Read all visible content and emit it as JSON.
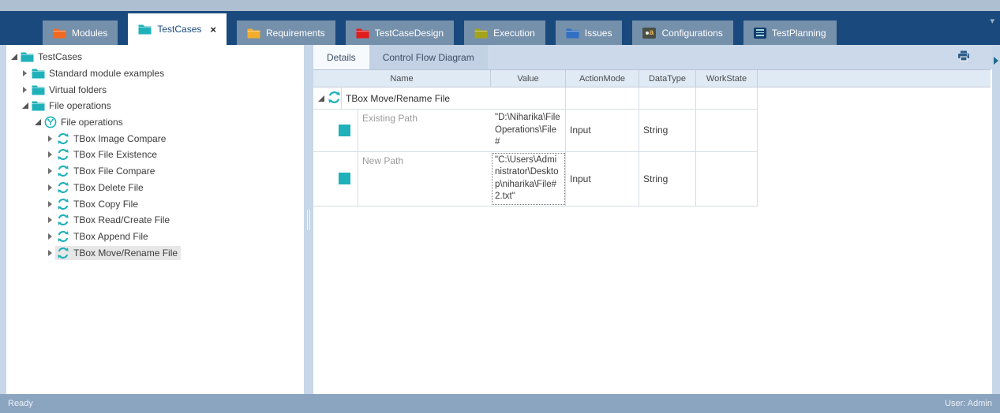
{
  "tabs": {
    "items": [
      {
        "label": "Modules",
        "icon": "folder",
        "color": "#f26a22",
        "active": false
      },
      {
        "label": "TestCases",
        "icon": "folder",
        "color": "#1fb1ba",
        "active": true,
        "close_glyph": "×"
      },
      {
        "label": "Requirements",
        "icon": "folder",
        "color": "#f2ad2d",
        "active": false
      },
      {
        "label": "TestCaseDesign",
        "icon": "folder",
        "color": "#e01d1d",
        "active": false
      },
      {
        "label": "Execution",
        "icon": "folder",
        "color": "#a3a41a",
        "active": false
      },
      {
        "label": "Issues",
        "icon": "folder",
        "color": "#2f6fc4",
        "active": false
      },
      {
        "label": "Configurations",
        "icon": "configurations",
        "config_a": "a",
        "active": false
      },
      {
        "label": "TestPlanning",
        "icon": "planning-list",
        "active": false
      }
    ],
    "overflow_glyph": "▾"
  },
  "tree": {
    "items": [
      {
        "label": "TestCases",
        "level": 0,
        "expander": "expanded",
        "icon": "folder-teal"
      },
      {
        "label": "Standard module examples",
        "level": 1,
        "expander": "collapsed",
        "icon": "folder-teal"
      },
      {
        "label": "Virtual folders",
        "level": 1,
        "expander": "collapsed",
        "icon": "folder-teal"
      },
      {
        "label": "File operations",
        "level": 1,
        "expander": "expanded",
        "icon": "folder-teal"
      },
      {
        "label": "File operations",
        "level": 2,
        "expander": "expanded",
        "icon": "testcase-folder"
      },
      {
        "label": "TBox Image Compare",
        "level": 3,
        "expander": "collapsed",
        "icon": "sync"
      },
      {
        "label": "TBox File Existence",
        "level": 3,
        "expander": "collapsed",
        "icon": "sync"
      },
      {
        "label": "TBox File Compare",
        "level": 3,
        "expander": "collapsed",
        "icon": "sync"
      },
      {
        "label": "TBox Delete File",
        "level": 3,
        "expander": "collapsed",
        "icon": "sync"
      },
      {
        "label": "TBox Copy File",
        "level": 3,
        "expander": "collapsed",
        "icon": "sync"
      },
      {
        "label": "TBox Read/Create File",
        "level": 3,
        "expander": "collapsed",
        "icon": "sync"
      },
      {
        "label": "TBox Append File",
        "level": 3,
        "expander": "collapsed",
        "icon": "sync"
      },
      {
        "label": "TBox Move/Rename File",
        "level": 3,
        "expander": "collapsed",
        "icon": "sync",
        "selected": true
      }
    ]
  },
  "right_panel": {
    "tabs": [
      {
        "label": "Details",
        "active": true
      },
      {
        "label": "Control Flow Diagram",
        "active": false
      }
    ],
    "table": {
      "columns": [
        "Name",
        "Value",
        "ActionMode",
        "DataType",
        "WorkState"
      ],
      "rows": [
        {
          "name": "TBox Move/Rename File",
          "icon": "sync",
          "expander": "expanded",
          "value": "",
          "action_mode": "",
          "data_type": "",
          "work_state": ""
        },
        {
          "name": "Existing Path",
          "icon": "teal-square",
          "value": "\"D:\\Niharika\\File Operations\\File#",
          "action_mode": "Input",
          "data_type": "String",
          "work_state": ""
        },
        {
          "name": "New Path",
          "icon": "teal-square",
          "focused": true,
          "value": "\"C:\\Users\\Administrator\\Desktop\\niharika\\File#2.txt\"",
          "action_mode": "Input",
          "data_type": "String",
          "work_state": ""
        }
      ]
    }
  },
  "statusbar": {
    "left": "Ready",
    "right": "User: Admin"
  },
  "colors": {
    "tabbar_bg": "#1a4a7d",
    "tab_inactive": "#7590ab",
    "accent_teal": "#1fb1ba",
    "panel_strip": "#c7d6e8",
    "header_strip": "#ccd9ea",
    "grid_header": "#e0eaf5",
    "status_bg": "#8ba4bf",
    "selection_bg": "#e7e7e7"
  }
}
